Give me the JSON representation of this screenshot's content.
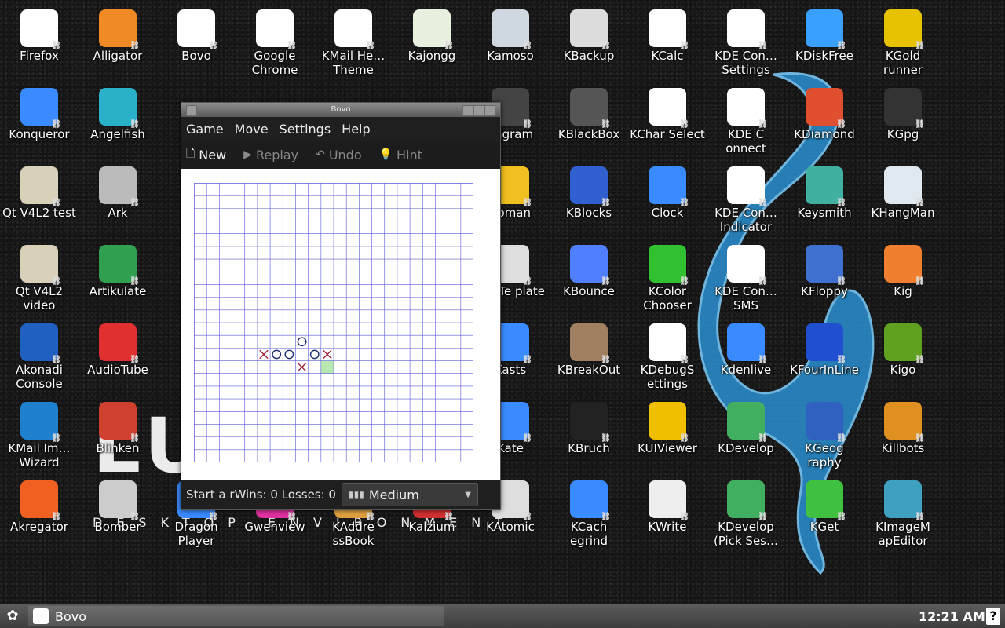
{
  "desktop": {
    "brand_big": "LU",
    "brand_small": "DESKTOP ENVIRONMENT",
    "icons": [
      {
        "label": "Firefox",
        "icon": "external-link-icon",
        "color": "#ffffff"
      },
      {
        "label": "Alligator",
        "icon": "alligator-icon",
        "color": "#f08a24"
      },
      {
        "label": "Bovo",
        "icon": "bovo-icon",
        "color": "#ffffff"
      },
      {
        "label": "Google Chrome",
        "icon": "chrome-icon",
        "color": "#ffffff"
      },
      {
        "label": "KMail He… Theme",
        "icon": "external-link-icon",
        "color": "#ffffff"
      },
      {
        "label": "Kajongg",
        "icon": "mahjong-icon",
        "color": "#e8f0e0"
      },
      {
        "label": "Kamoso",
        "icon": "camera-icon",
        "color": "#cfd8e0"
      },
      {
        "label": "KBackup",
        "icon": "backup-icon",
        "color": "#dcdcdc"
      },
      {
        "label": "KCalc",
        "icon": "calculator-icon",
        "color": "#ffffff"
      },
      {
        "label": "KDE Con… Settings",
        "icon": "kde-connect-icon",
        "color": "#ffffff"
      },
      {
        "label": "KDiskFree",
        "icon": "cubes-icon",
        "color": "#3aa0ff"
      },
      {
        "label": "KGold runner",
        "icon": "runner-icon",
        "color": "#e6c200"
      },
      {
        "label": "Konqueror",
        "icon": "konqueror-icon",
        "color": "#3a8bff"
      },
      {
        "label": "Angelfish",
        "icon": "fish-icon",
        "color": "#2ab0c8"
      },
      {
        "label": "hagram",
        "icon": "kana-icon",
        "color": "#444444"
      },
      {
        "label": "KBlackBox",
        "icon": "blackbox-icon",
        "color": "#555555"
      },
      {
        "label": "KChar Select",
        "icon": "character-icon",
        "color": "#ffffff"
      },
      {
        "label": "KDE C onnect",
        "icon": "kde-connect-icon",
        "color": "#ffffff"
      },
      {
        "label": "KDiamond",
        "icon": "diamond-icon",
        "color": "#e05030"
      },
      {
        "label": "KGpg",
        "icon": "lock-icon",
        "color": "#333333"
      },
      {
        "label": "Qt V4L2 test",
        "icon": "webcam-icon",
        "color": "#d8d0b8"
      },
      {
        "label": "Ark",
        "icon": "archive-icon",
        "color": "#bbbbbb"
      },
      {
        "label": "apman",
        "icon": "kapman-icon",
        "color": "#f0c020"
      },
      {
        "label": "KBlocks",
        "icon": "blocks-icon",
        "color": "#3060d0"
      },
      {
        "label": "Clock",
        "icon": "clock-icon",
        "color": "#3a8bff"
      },
      {
        "label": "KDE Con… Indicator",
        "icon": "kde-connect-icon",
        "color": "#ffffff"
      },
      {
        "label": "Keysmith",
        "icon": "keysmith-icon",
        "color": "#40b0a0"
      },
      {
        "label": "KHangMan",
        "icon": "hangman-icon",
        "color": "#e0e8f0"
      },
      {
        "label": "Qt V4L2 video",
        "icon": "webcam-icon",
        "color": "#d8d0b8"
      },
      {
        "label": "Artikulate",
        "icon": "globe-icon",
        "color": "#30a050"
      },
      {
        "label": "AppTe plate",
        "icon": "gear-icon",
        "color": "#dddddd"
      },
      {
        "label": "KBounce",
        "icon": "bounce-icon",
        "color": "#5080ff"
      },
      {
        "label": "KColor Chooser",
        "icon": "color-picker-icon",
        "color": "#30c030"
      },
      {
        "label": "KDE Con… SMS",
        "icon": "kde-connect-icon",
        "color": "#ffffff"
      },
      {
        "label": "KFloppy",
        "icon": "floppy-icon",
        "color": "#4070d0"
      },
      {
        "label": "Kig",
        "icon": "geometry-icon",
        "color": "#f08030"
      },
      {
        "label": "Akonadi Console",
        "icon": "akonadi-icon",
        "color": "#2060c0"
      },
      {
        "label": "AudioTube",
        "icon": "audio-icon",
        "color": "#e03030"
      },
      {
        "label": "Kasts",
        "icon": "podcast-icon",
        "color": "#3a8bff"
      },
      {
        "label": "KBreakOut",
        "icon": "breakout-icon",
        "color": "#a08060"
      },
      {
        "label": "KDebugS ettings",
        "icon": "external-link-icon",
        "color": "#ffffff"
      },
      {
        "label": "Kdenlive",
        "icon": "video-icon",
        "color": "#3a8bff"
      },
      {
        "label": "KFourInLine",
        "icon": "four-in-line-icon",
        "color": "#2050d0"
      },
      {
        "label": "Kigo",
        "icon": "go-board-icon",
        "color": "#60a020"
      },
      {
        "label": "KMail Im… Wizard",
        "icon": "import-icon",
        "color": "#2080d0"
      },
      {
        "label": "Blinken",
        "icon": "blinken-icon",
        "color": "#d04030"
      },
      {
        "label": "Kate",
        "icon": "kate-icon",
        "color": "#3a8bff"
      },
      {
        "label": "KBruch",
        "icon": "fraction-icon",
        "color": "#222222"
      },
      {
        "label": "KUIViewer",
        "icon": "gears-icon",
        "color": "#f0c000"
      },
      {
        "label": "KDevelop",
        "icon": "kdevelop-icon",
        "color": "#40b060"
      },
      {
        "label": "KGeog raphy",
        "icon": "map-icon",
        "color": "#3060c0"
      },
      {
        "label": "Killbots",
        "icon": "robot-icon",
        "color": "#e09020"
      },
      {
        "label": "Akregator",
        "icon": "rss-icon",
        "color": "#f06020"
      },
      {
        "label": "Bomber",
        "icon": "plane-icon",
        "color": "#cccccc"
      },
      {
        "label": "Dragon Player",
        "icon": "player-icon",
        "color": "#3a8bff"
      },
      {
        "label": "Gwenview",
        "icon": "image-viewer-icon",
        "color": "#e030a0"
      },
      {
        "label": "KAddre ssBook",
        "icon": "address-book-icon",
        "color": "#e0a040"
      },
      {
        "label": "Kalzium",
        "icon": "chemistry-icon",
        "color": "#d03030"
      },
      {
        "label": "KAtomic",
        "icon": "atom-icon",
        "color": "#dddddd"
      },
      {
        "label": "KCach egrind",
        "icon": "profiler-icon",
        "color": "#3a8bff"
      },
      {
        "label": "KWrite",
        "icon": "document-icon",
        "color": "#eeeeee"
      },
      {
        "label": "KDevelop (Pick Ses…",
        "icon": "kdevelop-icon",
        "color": "#40b060"
      },
      {
        "label": "KGet",
        "icon": "download-icon",
        "color": "#40c040"
      },
      {
        "label": "KImageM apEditor",
        "icon": "image-map-icon",
        "color": "#40a0c0"
      }
    ]
  },
  "window": {
    "title": "Bovo",
    "menu": [
      "Game",
      "Move",
      "Settings",
      "Help"
    ],
    "toolbar": {
      "new_label": "New",
      "replay_label": "Replay",
      "undo_label": "Undo",
      "hint_label": "Hint"
    },
    "status": {
      "text": "Start a rWins: 0  Losses: 0",
      "difficulty": "Medium"
    },
    "board": {
      "size": 22,
      "grid_color": "#5b5bd6",
      "pieces": [
        {
          "row": 12,
          "col": 8,
          "mark": "O",
          "color": "#1a2a6c"
        },
        {
          "row": 13,
          "col": 5,
          "mark": "X",
          "color": "#a0203a"
        },
        {
          "row": 13,
          "col": 6,
          "mark": "O",
          "color": "#1a2a6c"
        },
        {
          "row": 13,
          "col": 7,
          "mark": "O",
          "color": "#1a2a6c"
        },
        {
          "row": 13,
          "col": 9,
          "mark": "O",
          "color": "#1a2a6c"
        },
        {
          "row": 13,
          "col": 10,
          "mark": "X",
          "color": "#a0203a"
        },
        {
          "row": 14,
          "col": 8,
          "mark": "X",
          "color": "#a0203a"
        }
      ],
      "highlight": {
        "row": 14,
        "col": 10,
        "color": "#b8e8b0"
      }
    }
  },
  "taskbar": {
    "task_label": "Bovo",
    "clock": "12:21 AM",
    "help": "?"
  }
}
